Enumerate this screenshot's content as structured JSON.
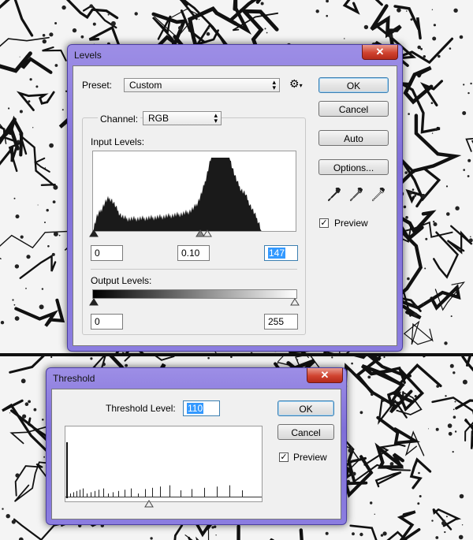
{
  "levels": {
    "title": "Levels",
    "close_glyph": "✕",
    "preset_label": "Preset:",
    "preset_value": "Custom",
    "channel_label": "Channel:",
    "channel_value": "RGB",
    "input_levels_label": "Input Levels:",
    "input_black": "0",
    "input_gamma": "0.10",
    "input_white": "147",
    "output_levels_label": "Output Levels:",
    "output_black": "0",
    "output_white": "255",
    "ok_label": "OK",
    "cancel_label": "Cancel",
    "auto_label": "Auto",
    "options_label": "Options...",
    "preview_label": "Preview",
    "preview_checked": true,
    "icons": [
      "gear-icon",
      "black-eyedropper-icon",
      "gray-eyedropper-icon",
      "white-eyedropper-icon"
    ]
  },
  "threshold": {
    "title": "Threshold",
    "close_glyph": "✕",
    "level_label": "Threshold Level:",
    "level_value": "110",
    "ok_label": "OK",
    "cancel_label": "Cancel",
    "preview_label": "Preview",
    "preview_checked": true
  },
  "colors": {
    "title_bar": "#8b7de0",
    "close_button": "#d0432f",
    "dialog_bg": "#f0f0f0",
    "selection": "#3399ff",
    "histogram_fill": "#1a1a1a"
  }
}
